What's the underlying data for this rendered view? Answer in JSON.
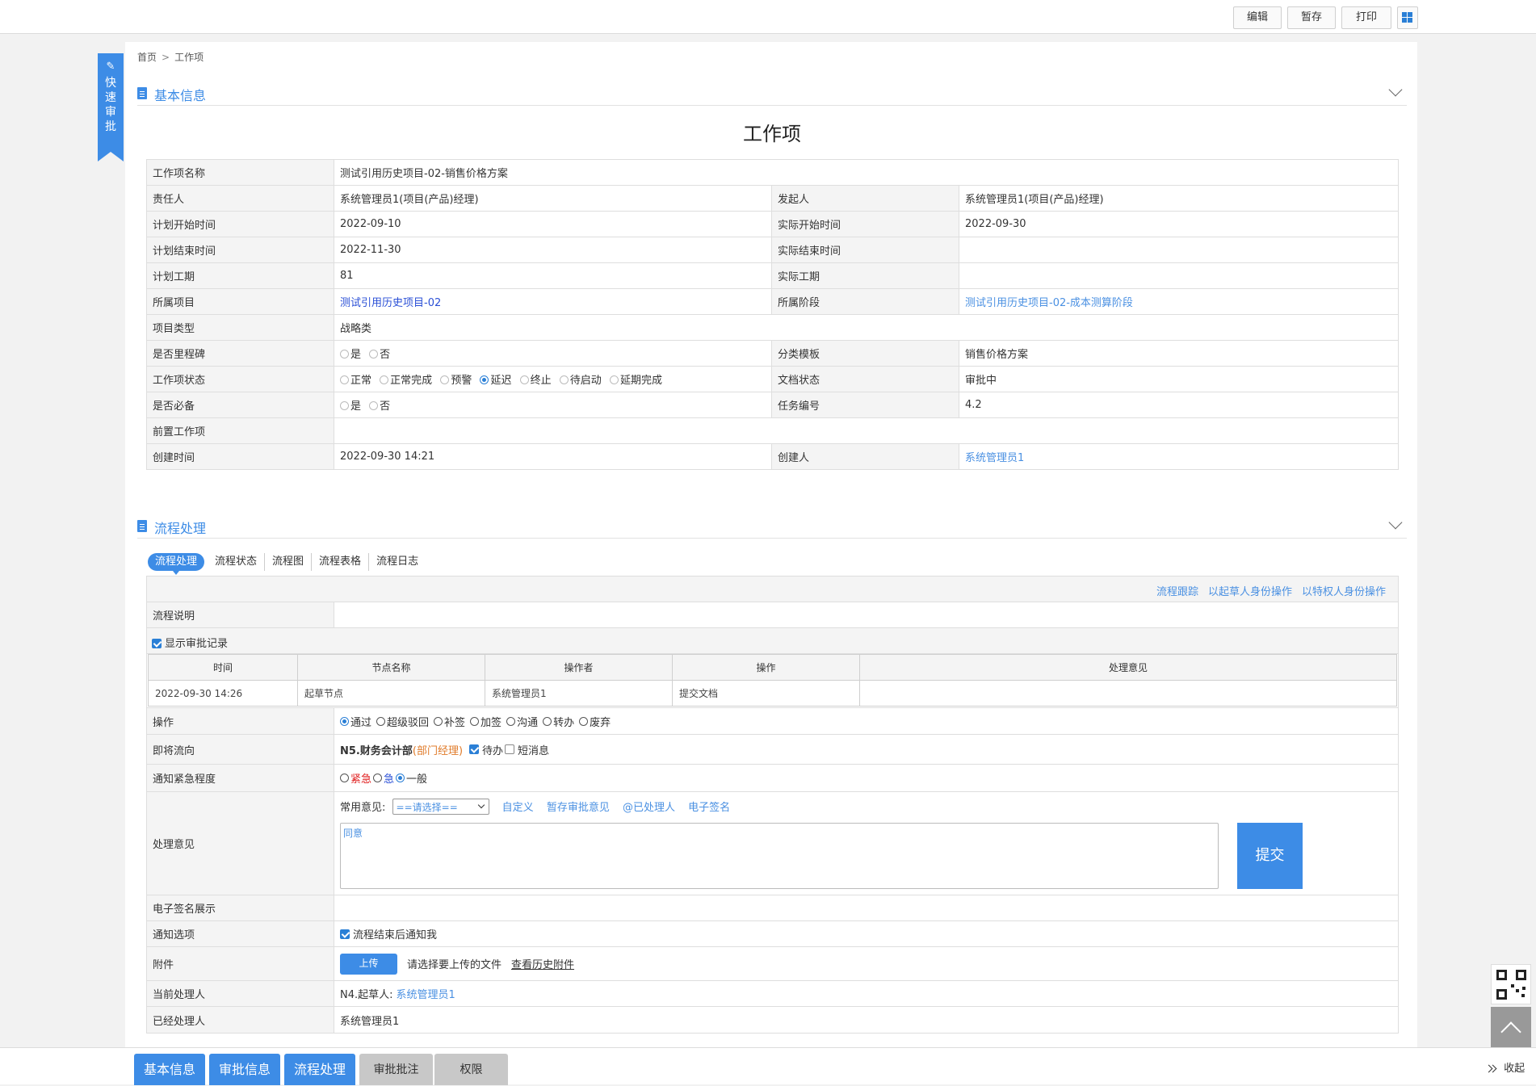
{
  "toolbar": {
    "edit": "编辑",
    "save_draft": "暂存",
    "print": "打印"
  },
  "quick_approve": "快速审批",
  "breadcrumb": {
    "home": "首页",
    "current": "工作项"
  },
  "sections": {
    "basic_info": "基本信息",
    "process": "流程处理"
  },
  "page_title": "工作项",
  "info": {
    "name_label": "工作项名称",
    "name": "测试引用历史项目-02-销售价格方案",
    "owner_label": "责任人",
    "owner": "系统管理员1(项目(产品)经理)",
    "initiator_label": "发起人",
    "initiator": "系统管理员1(项目(产品)经理)",
    "plan_start_label": "计划开始时间",
    "plan_start": "2022-09-10",
    "actual_start_label": "实际开始时间",
    "actual_start": "2022-09-30",
    "plan_end_label": "计划结束时间",
    "plan_end": "2022-11-30",
    "actual_end_label": "实际结束时间",
    "actual_end": "",
    "plan_duration_label": "计划工期",
    "plan_duration": "81",
    "actual_duration_label": "实际工期",
    "actual_duration": "",
    "project_label": "所属项目",
    "project": "测试引用历史项目-02",
    "stage_label": "所属阶段",
    "stage": "测试引用历史项目-02-成本测算阶段",
    "project_type_label": "项目类型",
    "project_type": "战略类",
    "milestone_label": "是否里程碑",
    "yes": "是",
    "no": "否",
    "template_label": "分类模板",
    "template": "销售价格方案",
    "status_label": "工作项状态",
    "status_options": [
      "正常",
      "正常完成",
      "预警",
      "延迟",
      "终止",
      "待启动",
      "延期完成"
    ],
    "status_selected": "延迟",
    "doc_status_label": "文档状态",
    "doc_status": "审批中",
    "required_label": "是否必备",
    "task_no_label": "任务编号",
    "task_no": "4.2",
    "predecessor_label": "前置工作项",
    "predecessor": "",
    "created_time_label": "创建时间",
    "created_time": "2022-09-30 14:21",
    "creator_label": "创建人",
    "creator": "系统管理员1"
  },
  "process_tabs": [
    "流程处理",
    "流程状态",
    "流程图",
    "流程表格",
    "流程日志"
  ],
  "process_links": [
    "流程跟踪",
    "以起草人身份操作",
    "以特权人身份操作"
  ],
  "process": {
    "desc_label": "流程说明",
    "desc": "",
    "show_records": "显示审批记录",
    "log_headers": [
      "时间",
      "节点名称",
      "操作者",
      "操作",
      "处理意见"
    ],
    "log_rows": [
      [
        "2022-09-30 14:26",
        "起草节点",
        "系统管理员1",
        "提交文档",
        ""
      ]
    ],
    "action_label": "操作",
    "action_options": [
      "通过",
      "超级驳回",
      "补签",
      "加签",
      "沟通",
      "转办",
      "废弃"
    ],
    "action_selected": "通过",
    "next_label": "即将流向",
    "next_node": "N5.财务会计部",
    "next_role": "(部门经理)",
    "todo": "待办",
    "sms": "短消息",
    "urgency_label": "通知紧急程度",
    "urgency_options": [
      "紧急",
      "急",
      "一般"
    ],
    "urgency_selected": "一般",
    "opinion_label": "处理意见",
    "common_opinion": "常用意见:",
    "select_placeholder": "==请选择==",
    "opinion_links": [
      "自定义",
      "暂存审批意见",
      "@已处理人",
      "电子签名"
    ],
    "opinion_text": "同意",
    "submit": "提交",
    "esign_label": "电子签名展示",
    "notify_label": "通知选项",
    "notify_option": "流程结束后通知我",
    "attach_label": "附件",
    "upload": "上传",
    "upload_hint": "请选择要上传的文件",
    "history_attach": "查看历史附件",
    "current_handler_label": "当前处理人",
    "current_handler_node": "N4.起草人: ",
    "current_handler": "系统管理员1",
    "handled_label": "已经处理人",
    "handled": "系统管理员1"
  },
  "bottom_tabs": [
    "基本信息",
    "审批信息",
    "流程处理",
    "审批批注",
    "权限"
  ],
  "collapse": "收起"
}
